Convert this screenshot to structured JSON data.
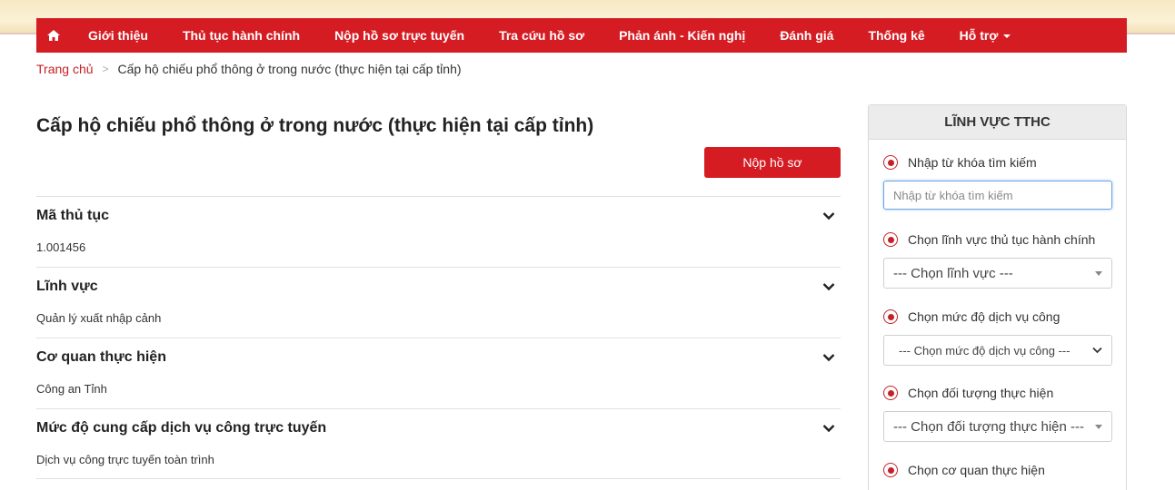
{
  "nav": {
    "home_icon": "home-icon",
    "items": [
      {
        "label": "Giới thiệu"
      },
      {
        "label": "Thủ tục hành chính"
      },
      {
        "label": "Nộp hồ sơ trực tuyến"
      },
      {
        "label": "Tra cứu hồ sơ"
      },
      {
        "label": "Phản ánh - Kiến nghị"
      },
      {
        "label": "Đánh giá"
      },
      {
        "label": "Thống kê"
      },
      {
        "label": "Hỗ trợ"
      }
    ]
  },
  "breadcrumb": {
    "home": "Trang chủ",
    "separator": ">",
    "current": "Cấp hộ chiếu phổ thông ở trong nước (thực hiện tại cấp tỉnh)"
  },
  "main": {
    "title": "Cấp hộ chiếu phổ thông ở trong nước (thực hiện tại cấp tỉnh)",
    "submit_label": "Nộp hồ sơ",
    "sections": [
      {
        "title": "Mã thủ tục",
        "value": "1.001456"
      },
      {
        "title": "Lĩnh vực",
        "value": "Quản lý xuất nhập cảnh"
      },
      {
        "title": "Cơ quan thực hiện",
        "value": "Công an Tỉnh"
      },
      {
        "title": "Mức độ cung cấp dịch vụ công trực tuyến",
        "value": "Dịch vụ công trực tuyến toàn trình"
      }
    ]
  },
  "sidebar": {
    "title": "LĨNH VỰC TTHC",
    "filters": [
      {
        "label": "Nhập từ khóa tìm kiếm",
        "placeholder": "Nhập từ khóa tìm kiếm"
      },
      {
        "label": "Chọn lĩnh vực thủ tục hành chính",
        "selected": "--- Chọn lĩnh vực ---"
      },
      {
        "label": "Chọn mức độ dịch vụ công",
        "selected": "--- Chọn mức độ dịch vụ công ---"
      },
      {
        "label": "Chọn đối tượng thực hiện",
        "selected": "--- Chọn đối tượng thực hiện ---"
      },
      {
        "label": "Chọn cơ quan thực hiện"
      }
    ]
  },
  "colors": {
    "brand_red": "#d51c23",
    "link_red": "#c62026",
    "focus_blue": "#6aa4e6"
  }
}
